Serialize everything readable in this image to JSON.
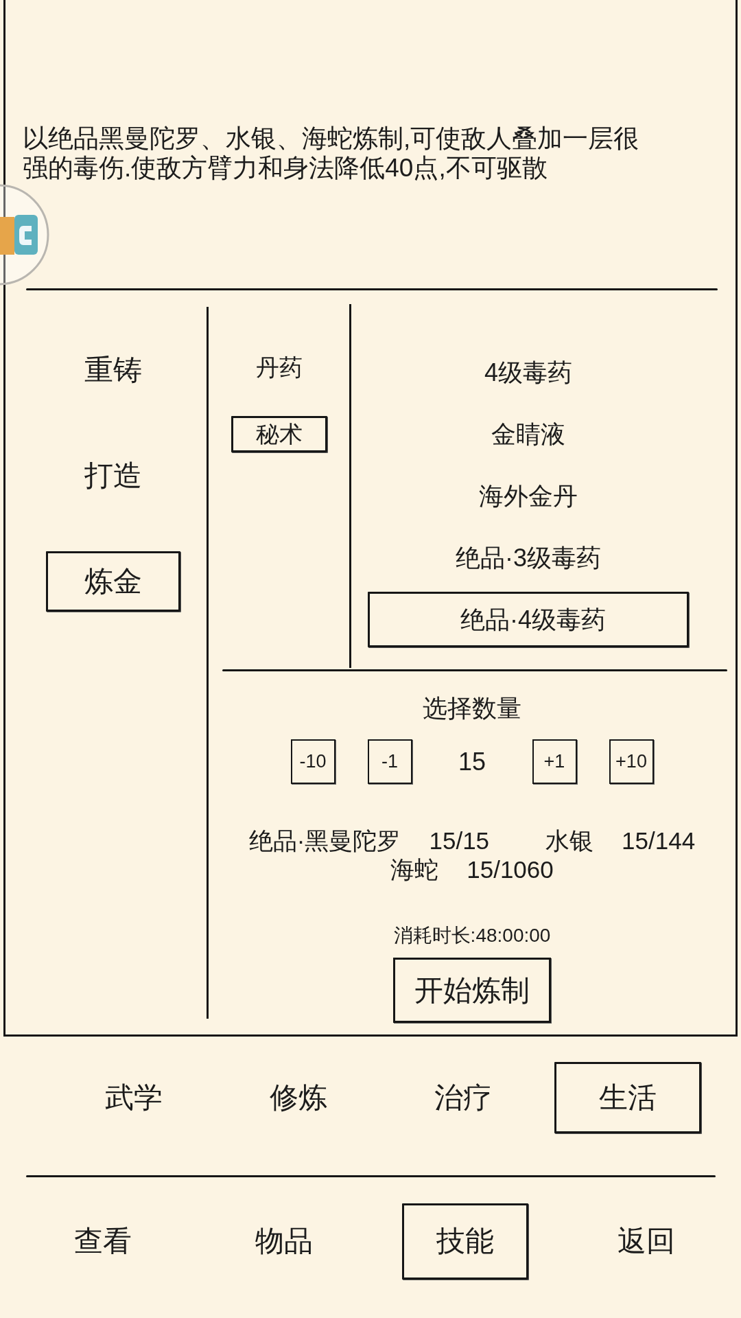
{
  "description": "以绝品黑曼陀罗、水银、海蛇炼制,可使敌人叠加一层很强的毒伤.使敌方臂力和身法降低40点,不可驱散",
  "craft_types": [
    {
      "label": "重铸",
      "selected": false
    },
    {
      "label": "打造",
      "selected": false
    },
    {
      "label": "炼金",
      "selected": true
    }
  ],
  "categories": [
    {
      "label": "丹药",
      "selected": false
    },
    {
      "label": "秘术",
      "selected": true
    }
  ],
  "recipes": [
    {
      "label": "4级毒药",
      "selected": false
    },
    {
      "label": "金睛液",
      "selected": false
    },
    {
      "label": "海外金丹",
      "selected": false
    },
    {
      "label": "绝品·3级毒药",
      "selected": false
    },
    {
      "label": "绝品·4级毒药",
      "selected": true
    }
  ],
  "quantity": {
    "title": "选择数量",
    "decrease_buttons": [
      "-10",
      "-1"
    ],
    "value": "15",
    "increase_buttons": [
      "+1",
      "+10"
    ]
  },
  "materials": [
    {
      "name": "绝品·黑曼陀罗",
      "count": "15/15"
    },
    {
      "name": "水银",
      "count": "15/144"
    },
    {
      "name": "海蛇",
      "count": "15/1060"
    }
  ],
  "duration": "消耗时长:48:00:00",
  "start_button": "开始炼制",
  "skill_tabs": [
    {
      "label": "武学",
      "selected": false
    },
    {
      "label": "修炼",
      "selected": false
    },
    {
      "label": "治疗",
      "selected": false
    },
    {
      "label": "生活",
      "selected": true
    }
  ],
  "bottom_nav": [
    {
      "label": "查看",
      "selected": false
    },
    {
      "label": "物品",
      "selected": false
    },
    {
      "label": "技能",
      "selected": true
    },
    {
      "label": "返回",
      "selected": false
    }
  ]
}
